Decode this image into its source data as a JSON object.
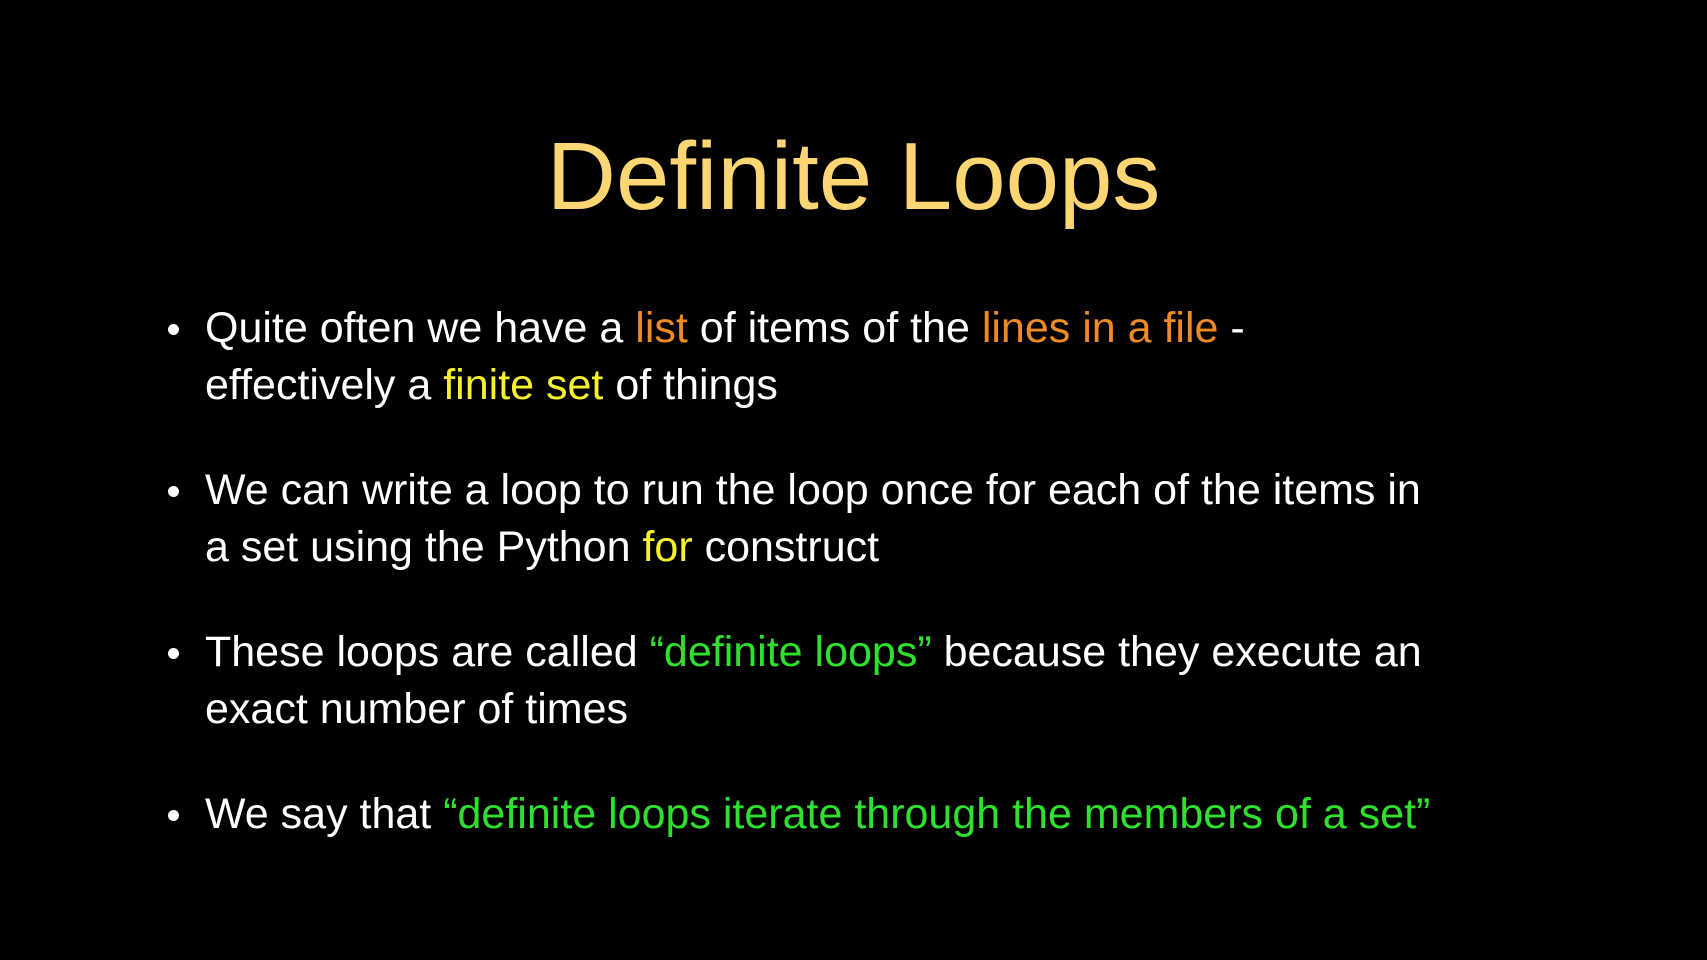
{
  "slide": {
    "title": "Definite Loops",
    "colors": {
      "background": "#000000",
      "title": "#fcd673",
      "body_text": "#ffffff",
      "orange_highlight": "#f08a24",
      "yellow_highlight": "#f7f02c",
      "green_highlight": "#2fe02f"
    },
    "bullets": [
      {
        "parts": [
          "Quite often we have a ",
          "list",
          " of items of the ",
          "lines in a file",
          " -",
          "effectively a ",
          "finite set",
          " of things"
        ]
      },
      {
        "parts": [
          "We can write a loop to run the loop once for each of the items in",
          "a set using the Python ",
          "for",
          " construct"
        ]
      },
      {
        "parts": [
          "These loops are called ",
          "“definite loops”",
          " because they execute an",
          "exact number of times"
        ]
      },
      {
        "parts": [
          "We say that ",
          "“definite loops iterate through the members of a set”"
        ]
      }
    ]
  }
}
